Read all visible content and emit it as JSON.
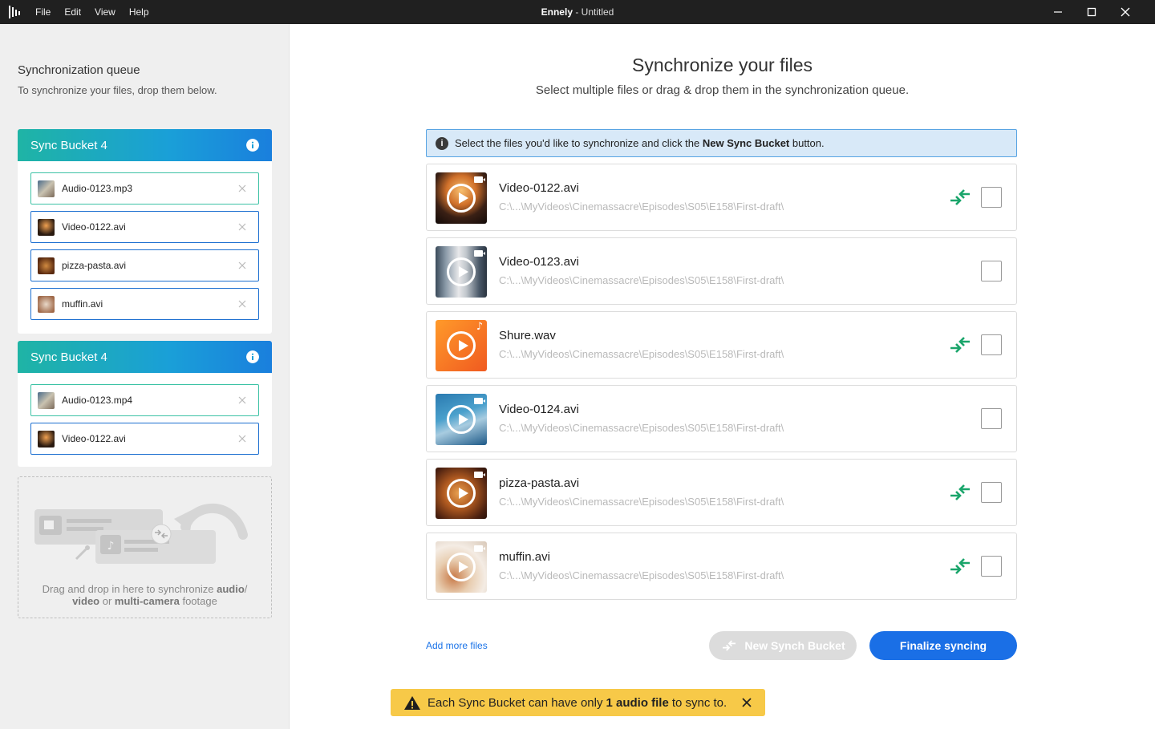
{
  "window": {
    "app_name": "Ennely",
    "separator": " - ",
    "doc_name": "Untitled",
    "menu": [
      "File",
      "Edit",
      "View",
      "Help"
    ]
  },
  "sidebar": {
    "title": "Synchronization queue",
    "subtitle": "To synchronize your files, drop them below.",
    "buckets": [
      {
        "title": "Sync Bucket 4",
        "files": [
          {
            "name": "Audio-0123.mp3",
            "kind": "audio"
          },
          {
            "name": "Video-0122.avi",
            "kind": "video"
          },
          {
            "name": "pizza-pasta.avi",
            "kind": "video"
          },
          {
            "name": "muffin.avi",
            "kind": "video"
          }
        ]
      },
      {
        "title": "Sync Bucket 4",
        "files": [
          {
            "name": "Audio-0123.mp4",
            "kind": "audio"
          },
          {
            "name": "Video-0122.avi",
            "kind": "video"
          }
        ]
      }
    ],
    "dropzone": {
      "t1": "Drag and drop in here to synchronize ",
      "b1": "audio",
      "t2": "/",
      "b2": "video",
      "t3": " or ",
      "b3": "multi-camera",
      "t4": " footage"
    }
  },
  "main": {
    "title": "Synchronize your files",
    "subtitle": "Select multiple files or drag & drop them in the synchronization queue.",
    "banner": {
      "pre": "Select the files you'd like to synchronize and click the ",
      "bold": "New Sync Bucket",
      "post": " button."
    },
    "files": [
      {
        "name": "Video-0122.avi",
        "path": "C:\\...\\MyVideos\\Cinemassacre\\Episodes\\S05\\E158\\First-draft\\",
        "synced": true
      },
      {
        "name": "Video-0123.avi",
        "path": "C:\\...\\MyVideos\\Cinemassacre\\Episodes\\S05\\E158\\First-draft\\",
        "synced": false
      },
      {
        "name": "Shure.wav",
        "path": "C:\\...\\MyVideos\\Cinemassacre\\Episodes\\S05\\E158\\First-draft\\",
        "synced": true
      },
      {
        "name": "Video-0124.avi",
        "path": "C:\\...\\MyVideos\\Cinemassacre\\Episodes\\S05\\E158\\First-draft\\",
        "synced": false
      },
      {
        "name": "pizza-pasta.avi",
        "path": "C:\\...\\MyVideos\\Cinemassacre\\Episodes\\S05\\E158\\First-draft\\",
        "synced": true
      },
      {
        "name": "muffin.avi",
        "path": "C:\\...\\MyVideos\\Cinemassacre\\Episodes\\S05\\E158\\First-draft\\",
        "synced": true
      }
    ],
    "add_more": "Add more files",
    "new_bucket_button": "New Synch Bucket",
    "finalize_button": "Finalize syncing"
  },
  "toast": {
    "pre": "Each Sync Bucket can have only",
    "bold": "1 audio file",
    "post": "to sync to."
  },
  "colors": {
    "accent": "#1a6fe6",
    "sync_green": "#1aa56b",
    "toast_bg": "#f7c948"
  }
}
